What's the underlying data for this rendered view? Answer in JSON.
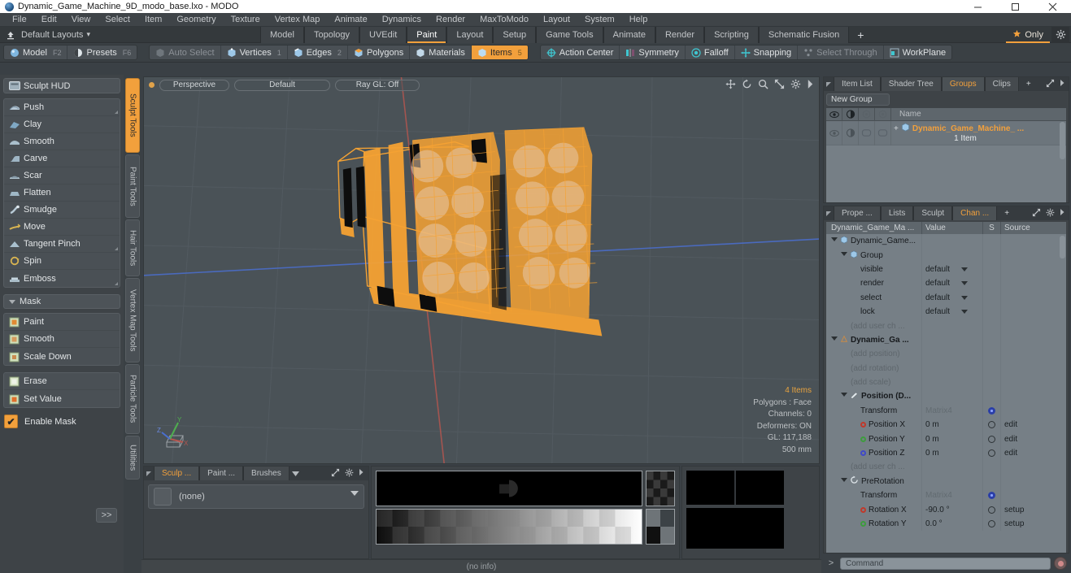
{
  "window": {
    "title": "Dynamic_Game_Machine_9D_modo_base.lxo - MODO",
    "minimize": "minimize-icon",
    "maximize": "maximize-icon",
    "close": "close-icon"
  },
  "menubar": {
    "items": [
      "File",
      "Edit",
      "View",
      "Select",
      "Item",
      "Geometry",
      "Texture",
      "Vertex Map",
      "Animate",
      "Dynamics",
      "Render",
      "MaxToModo",
      "Layout",
      "System",
      "Help"
    ]
  },
  "layoutbar": {
    "layouts_label": "Default Layouts",
    "caret": "▾",
    "tabs": [
      {
        "label": "Model",
        "active": false
      },
      {
        "label": "Topology",
        "active": false
      },
      {
        "label": "UVEdit",
        "active": false
      },
      {
        "label": "Paint",
        "active": true
      },
      {
        "label": "Layout",
        "active": false
      },
      {
        "label": "Setup",
        "active": false
      },
      {
        "label": "Game Tools",
        "active": false
      },
      {
        "label": "Animate",
        "active": false
      },
      {
        "label": "Render",
        "active": false
      },
      {
        "label": "Scripting",
        "active": false
      },
      {
        "label": "Schematic Fusion",
        "active": false
      }
    ],
    "plus": "+",
    "only_label": "Only",
    "star_icon": "star-icon",
    "gear_icon": "gear-icon"
  },
  "modebar": {
    "left": [
      {
        "label": "Model",
        "key": "F2",
        "icon": "sphere-icon",
        "state": "normal"
      },
      {
        "label": "Presets",
        "key": "F6",
        "icon": "halfsphere-icon",
        "state": "normal"
      }
    ],
    "selection": [
      {
        "label": "Auto Select",
        "key": "",
        "icon": "cube-icon",
        "state": "dim"
      },
      {
        "label": "Vertices",
        "key": "1",
        "icon": "cube-icon",
        "state": "normal"
      },
      {
        "label": "Edges",
        "key": "2",
        "icon": "cube-icon",
        "state": "normal"
      },
      {
        "label": "Polygons",
        "key": "",
        "icon": "cube-icon",
        "state": "normal"
      },
      {
        "label": "Materials",
        "key": "",
        "icon": "cube-icon",
        "state": "normal"
      },
      {
        "label": "Items",
        "key": "5",
        "icon": "cube-icon",
        "state": "selected"
      }
    ],
    "right": [
      {
        "label": "Action Center",
        "icon": "crosshair-icon",
        "state": "normal"
      },
      {
        "label": "Symmetry",
        "icon": "symmetry-icon",
        "state": "normal"
      },
      {
        "label": "Falloff",
        "icon": "falloff-icon",
        "state": "normal"
      },
      {
        "label": "Snapping",
        "icon": "snap-icon",
        "state": "normal"
      },
      {
        "label": "Select Through",
        "icon": "selectthrough-icon",
        "state": "dim"
      },
      {
        "label": "WorkPlane",
        "icon": "workplane-icon",
        "state": "normal"
      }
    ]
  },
  "left_panel": {
    "hud_button": "Sculpt HUD",
    "hud_icon": "hud-icon",
    "sculpt_tools": [
      {
        "label": "Push",
        "icon": "push-icon",
        "corner": true
      },
      {
        "label": "Clay",
        "icon": "clay-icon",
        "corner": false
      },
      {
        "label": "Smooth",
        "icon": "smooth-icon",
        "corner": false
      },
      {
        "label": "Carve",
        "icon": "carve-icon",
        "corner": false
      },
      {
        "label": "Scar",
        "icon": "scar-icon",
        "corner": false
      },
      {
        "label": "Flatten",
        "icon": "flatten-icon",
        "corner": false
      },
      {
        "label": "Smudge",
        "icon": "smudge-icon",
        "corner": false
      },
      {
        "label": "Move",
        "icon": "move-icon",
        "corner": false
      },
      {
        "label": "Tangent Pinch",
        "icon": "pinch-icon",
        "corner": true
      },
      {
        "label": "Spin",
        "icon": "spin-icon",
        "corner": false
      },
      {
        "label": "Emboss",
        "icon": "emboss-icon",
        "corner": true
      }
    ],
    "mask_header": "Mask",
    "mask_tools_a": [
      {
        "label": "Paint",
        "icon": "mask-paint-icon"
      },
      {
        "label": "Smooth",
        "icon": "mask-smooth-icon"
      },
      {
        "label": "Scale Down",
        "icon": "mask-scale-icon"
      }
    ],
    "mask_tools_b": [
      {
        "label": "Erase",
        "icon": "mask-erase-icon"
      },
      {
        "label": "Set Value",
        "icon": "mask-setvalue-icon"
      }
    ],
    "enable_mask_label": "Enable Mask",
    "enable_mask_checked": "✔",
    "expand_button": ">>"
  },
  "vertical_tabs": [
    {
      "label": "Sculpt Tools",
      "active": true
    },
    {
      "label": "Paint Tools",
      "active": false
    },
    {
      "label": "Hair Tools",
      "active": false
    },
    {
      "label": "Vertex Map Tools",
      "active": false
    },
    {
      "label": "Particle Tools",
      "active": false
    },
    {
      "label": "Utilities",
      "active": false
    }
  ],
  "viewport": {
    "view_button": "Perspective",
    "shading_button": "Default",
    "raygl_button": "Ray GL: Off",
    "tool_icons": [
      "pan-icon",
      "rotate-icon",
      "zoom-icon",
      "fit-icon",
      "gear-icon",
      "caret-right-icon"
    ],
    "info": {
      "items": "4 Items",
      "polygons": "Polygons : Face",
      "channels": "Channels: 0",
      "deformers": "Deformers: ON",
      "gl": "GL: 117,188",
      "scale": "500 mm"
    },
    "axis": {
      "x": "X",
      "y": "Y",
      "z": "Z"
    },
    "colors": {
      "background": "#4a5257",
      "model_wire": "#f5a233",
      "axis_x": "#c0504d",
      "axis_z": "#4a6fd0"
    }
  },
  "bottom_left": {
    "tabs": [
      {
        "label": "Sculp ...",
        "active": true
      },
      {
        "label": "Paint ...",
        "active": false
      },
      {
        "label": "Brushes",
        "active": false
      }
    ],
    "caret_icon": "chevron-down-icon",
    "expand_icon": "expand-icon",
    "gear_icon": "gear-icon",
    "arrow_icon": "caret-right-icon",
    "brush_value": "(none)"
  },
  "bottom_status": "(no info)",
  "right_panel": {
    "top_tabs": [
      {
        "label": "Item List",
        "active": false
      },
      {
        "label": "Shader Tree",
        "active": false
      },
      {
        "label": "Groups",
        "active": true
      },
      {
        "label": "Clips",
        "active": false
      }
    ],
    "top_tabs_plus": "+",
    "new_group_button": "New Group",
    "grid_headers": {
      "eye": "visibility-icon",
      "render": "render-icon",
      "lock": "lock-icon",
      "select": "select-icon",
      "name": "Name"
    },
    "group_row": {
      "name": "Dynamic_Game_Machine_ ...",
      "sub": "1 Item",
      "expander": "+",
      "item_icon": "group-icon"
    },
    "channel_tabs": [
      {
        "label": "Prope ...",
        "active": false
      },
      {
        "label": "Lists",
        "active": false
      },
      {
        "label": "Sculpt",
        "active": false
      },
      {
        "label": "Chan ...",
        "active": true
      }
    ],
    "channel_tabs_plus": "+",
    "channel_headers": {
      "name": "Dynamic_Game_Ma ...",
      "value": "Value",
      "s": "S",
      "source": "Source"
    },
    "channel_rows": [
      {
        "indent": 1,
        "name": "Dynamic_Game...",
        "value": "",
        "s": "",
        "source": "",
        "kind": "tree",
        "icon": "group-icon",
        "expander": "down",
        "bold": false
      },
      {
        "indent": 2,
        "name": "Group",
        "value": "",
        "s": "",
        "source": "",
        "kind": "tree",
        "icon": "group-icon",
        "expander": "down",
        "bold": false
      },
      {
        "indent": 3,
        "name": "visible",
        "value": "default",
        "s": "",
        "source": "",
        "kind": "dropdown",
        "bold": false
      },
      {
        "indent": 3,
        "name": "render",
        "value": "default",
        "s": "",
        "source": "",
        "kind": "dropdown",
        "bold": false
      },
      {
        "indent": 3,
        "name": "select",
        "value": "default",
        "s": "",
        "source": "",
        "kind": "dropdown",
        "bold": false
      },
      {
        "indent": 3,
        "name": "lock",
        "value": "default",
        "s": "",
        "source": "",
        "kind": "dropdown",
        "bold": false
      },
      {
        "indent": 3,
        "name": "(add user ch ...",
        "value": "",
        "s": "",
        "source": "",
        "kind": "dim",
        "bold": false
      },
      {
        "indent": 1,
        "name": "Dynamic_Ga ...",
        "value": "",
        "s": "",
        "source": "",
        "kind": "tree",
        "icon": "mesh-icon",
        "expander": "down",
        "bold": true
      },
      {
        "indent": 3,
        "name": "(add position)",
        "value": "",
        "s": "",
        "source": "",
        "kind": "dim",
        "bold": false
      },
      {
        "indent": 3,
        "name": "(add rotation)",
        "value": "",
        "s": "",
        "source": "",
        "kind": "dim",
        "bold": false
      },
      {
        "indent": 3,
        "name": "(add scale)",
        "value": "",
        "s": "",
        "source": "",
        "kind": "dim",
        "bold": false
      },
      {
        "indent": 2,
        "name": "Position (D...",
        "value": "",
        "s": "",
        "source": "",
        "kind": "tree",
        "icon": "pos-icon",
        "expander": "down",
        "bold": true
      },
      {
        "indent": 3,
        "name": "Transform",
        "value": "Matrix4",
        "s": "blue",
        "source": "",
        "kind": "matrix",
        "bold": false
      },
      {
        "indent": 3,
        "name": "Position X",
        "value": "0 m",
        "s": "ring",
        "source": "edit",
        "kind": "axis",
        "dot": "#d04a4a",
        "bold": false
      },
      {
        "indent": 3,
        "name": "Position Y",
        "value": "0 m",
        "s": "ring",
        "source": "edit",
        "kind": "axis",
        "dot": "#4ea84e",
        "bold": false
      },
      {
        "indent": 3,
        "name": "Position Z",
        "value": "0 m",
        "s": "ring",
        "source": "edit",
        "kind": "axis",
        "dot": "#5a62d8",
        "bold": false
      },
      {
        "indent": 3,
        "name": "(add user ch ...",
        "value": "",
        "s": "",
        "source": "",
        "kind": "dim",
        "bold": false
      },
      {
        "indent": 2,
        "name": "PreRotation",
        "value": "",
        "s": "",
        "source": "",
        "kind": "tree",
        "icon": "rot-icon",
        "expander": "down",
        "bold": false
      },
      {
        "indent": 3,
        "name": "Transform",
        "value": "Matrix4",
        "s": "blue",
        "source": "",
        "kind": "matrix",
        "bold": false
      },
      {
        "indent": 3,
        "name": "Rotation X",
        "value": "-90.0 °",
        "s": "ring",
        "source": "setup",
        "kind": "axis",
        "dot": "#d04a4a",
        "bold": false
      },
      {
        "indent": 3,
        "name": "Rotation Y",
        "value": "0.0 °",
        "s": "ring",
        "source": "setup",
        "kind": "axis",
        "dot": "#4ea84e",
        "bold": false
      }
    ],
    "command_bar": {
      "prefix": ">",
      "placeholder": "Command",
      "record_icon": "record-icon"
    }
  }
}
